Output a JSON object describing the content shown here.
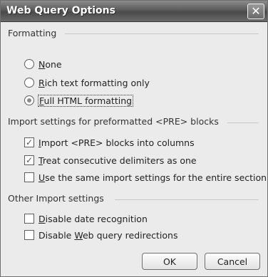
{
  "window": {
    "title": "Web Query Options"
  },
  "formatting": {
    "label": "Formatting",
    "options": [
      {
        "label": "None",
        "accel": "N",
        "checked": false
      },
      {
        "label": "Rich text formatting only",
        "accel": "R",
        "checked": false
      },
      {
        "label": "Full HTML formatting",
        "accel": "F",
        "checked": true
      }
    ]
  },
  "pre_settings": {
    "label": "Import settings for preformatted <PRE> blocks",
    "options": [
      {
        "label": "Import <PRE> blocks into columns",
        "accel": "I",
        "checked": true
      },
      {
        "label": "Treat consecutive delimiters as one",
        "accel": "T",
        "checked": true
      },
      {
        "label": "Use the same import settings for the entire section",
        "accel": "U",
        "checked": false
      }
    ]
  },
  "other_settings": {
    "label": "Other Import settings",
    "options": [
      {
        "label": "Disable date recognition",
        "accel": "D",
        "checked": false
      },
      {
        "label": "Disable Web query redirections",
        "accel": "W",
        "checked": false
      }
    ]
  },
  "buttons": {
    "ok": "OK",
    "cancel": "Cancel"
  },
  "icons": {
    "close": "close-icon",
    "checkmark": "checkmark-icon"
  }
}
